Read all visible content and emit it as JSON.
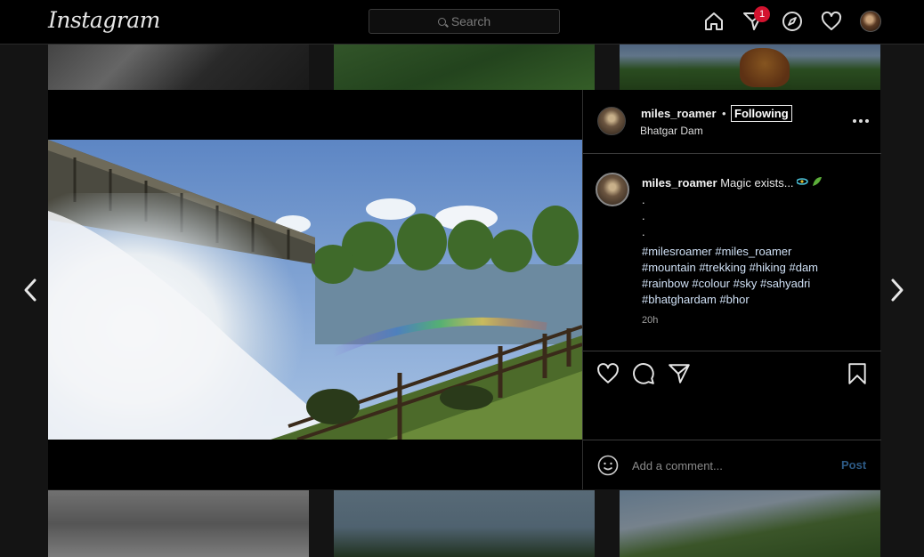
{
  "nav": {
    "logo": "Instagram",
    "search_placeholder": "Search",
    "notification_count": "1"
  },
  "post": {
    "username": "miles_roamer",
    "separator": "•",
    "follow_status": "Following",
    "location": "Bhatgar Dam",
    "caption": {
      "text": "Magic exists...",
      "dots": [
        ".",
        ".",
        "."
      ],
      "hashtags_lines": [
        "#milesroamer #miles_roamer",
        "#mountain #trekking #hiking #dam",
        "#rainbow #colour #sky #sahyadri",
        "#bhatghardam #bhor"
      ],
      "time": "20h"
    },
    "comment": {
      "placeholder": "Add a comment...",
      "post_label": "Post"
    }
  },
  "colors": {
    "background": "#141414",
    "panel": "#000000",
    "badge": "#d3132f",
    "post_button": "#2d5a85",
    "hashtag": "#cfe0f5"
  },
  "icons": [
    "home-icon",
    "direct-message-icon",
    "explore-icon",
    "activity-heart-icon",
    "like-icon",
    "comment-icon",
    "share-icon",
    "save-icon",
    "emoji-icon",
    "chevron-left-icon",
    "chevron-right-icon"
  ]
}
